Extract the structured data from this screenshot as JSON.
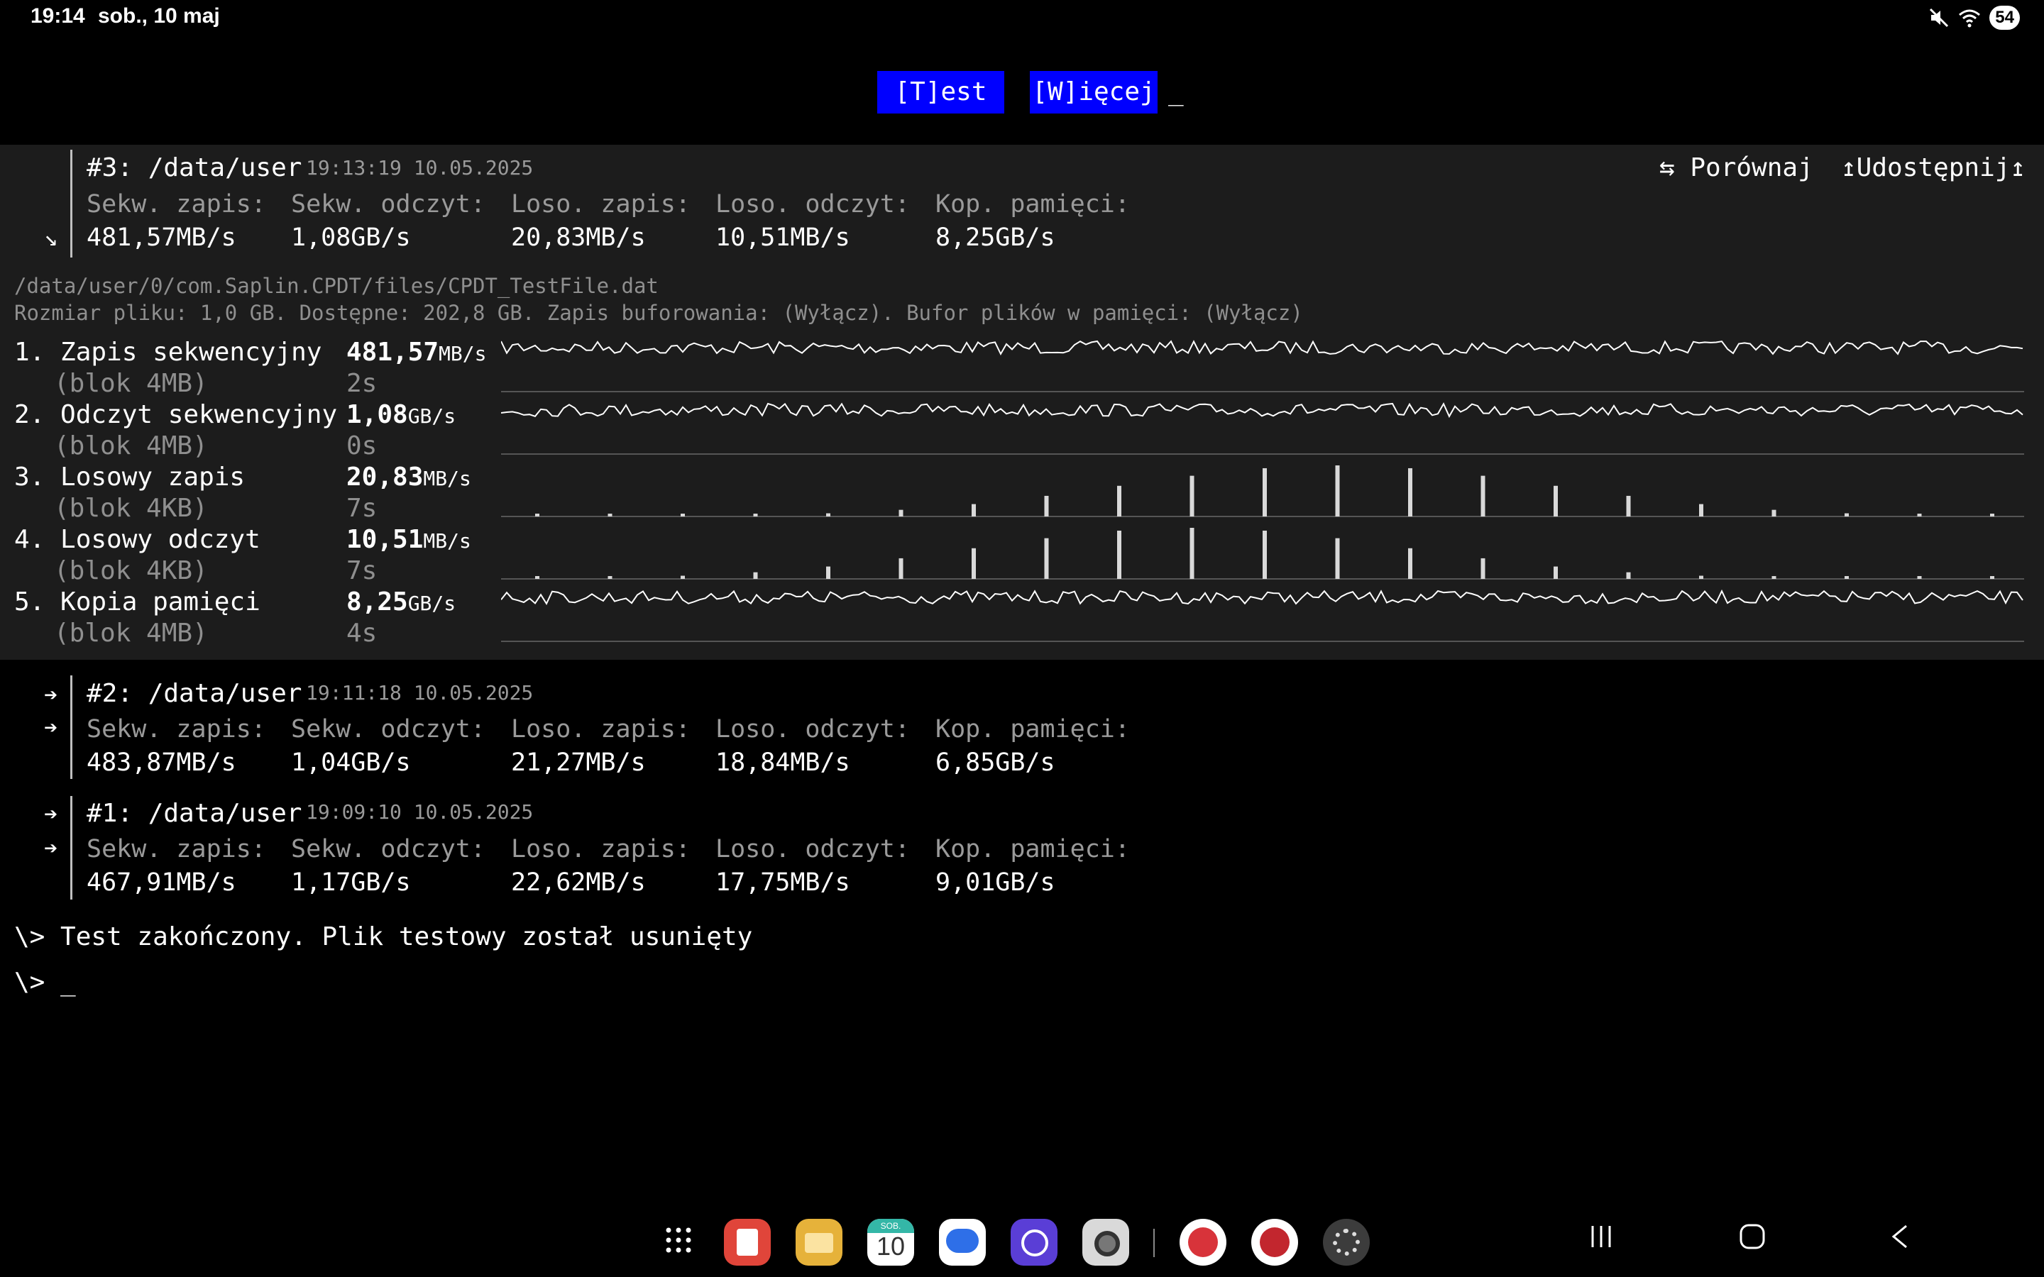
{
  "status_bar": {
    "time": "19:14",
    "date": "sob., 10 maj",
    "battery": "54",
    "icons": [
      "mute-icon",
      "wifi-icon",
      "battery-icon"
    ]
  },
  "menu": {
    "test": "[T]est",
    "more": "[W]ięcej",
    "cursor": "_"
  },
  "headers": [
    "Sekw. zapis:",
    "Sekw. odczyt:",
    "Loso. zapis:",
    "Loso. odczyt:",
    "Kop. pamięci:"
  ],
  "results": [
    {
      "title": "#3: /data/user",
      "timestamp": "19:13:19 10.05.2025",
      "values": [
        "481,57MB/s",
        "1,08GB/s",
        "20,83MB/s",
        "10,51MB/s",
        "8,25GB/s"
      ],
      "expand_glyph": "↘",
      "compare": "⇆ Porównaj",
      "share": "↥Udostępnij↥"
    },
    {
      "title": "#2: /data/user",
      "timestamp": "19:11:18 10.05.2025",
      "values": [
        "483,87MB/s",
        "1,04GB/s",
        "21,27MB/s",
        "18,84MB/s",
        "6,85GB/s"
      ]
    },
    {
      "title": "#1: /data/user",
      "timestamp": "19:09:10 10.05.2025",
      "values": [
        "467,91MB/s",
        "1,17GB/s",
        "22,62MB/s",
        "17,75MB/s",
        "9,01GB/s"
      ]
    }
  ],
  "details": {
    "file_path": "/data/user/0/com.Saplin.CPDT/files/CPDT_TestFile.dat",
    "file_info": "Rozmiar pliku: 1,0 GB. Dostępne: 202,8 GB. Zapis buforowania: (Wyłącz). Bufor plików w pamięci: (Wyłącz)"
  },
  "tests": [
    {
      "name": "1. Zapis sekwencyjny",
      "block": "(blok 4MB)",
      "value": "481,57",
      "unit": "MB/s",
      "time": "2s",
      "graph": "line"
    },
    {
      "name": "2. Odczyt sekwencyjny",
      "block": "(blok 4MB)",
      "value": "1,08",
      "unit": "GB/s",
      "time": "0s",
      "graph": "line"
    },
    {
      "name": "3. Losowy zapis",
      "block": "(blok 4KB)",
      "value": "20,83",
      "unit": "MB/s",
      "time": "7s",
      "graph": "bars"
    },
    {
      "name": "4. Losowy odczyt",
      "block": "(blok 4KB)",
      "value": "10,51",
      "unit": "MB/s",
      "time": "7s",
      "graph": "bars"
    },
    {
      "name": "5. Kopia pamięci",
      "block": "(blok 4MB)",
      "value": "8,25",
      "unit": "GB/s",
      "time": "4s",
      "graph": "line"
    }
  ],
  "terminal": {
    "message": "\\> Test zakończony. Plik testowy został usunięty",
    "prompt": "\\> _"
  },
  "dock": {
    "calendar_day": "10",
    "calendar_month": "SOB.",
    "apps": [
      "notes-app-icon",
      "files-app-icon",
      "calendar-app-icon",
      "messages-app-icon",
      "internet-app-icon",
      "camera-app-icon",
      "antutu-app-icon",
      "antutu-3d-app-icon",
      "settings-app-icon"
    ]
  },
  "colors": {
    "menu_button": "#0000ff",
    "panel_bg": "#1c1c1c",
    "muted_text": "#9a9a9a"
  }
}
